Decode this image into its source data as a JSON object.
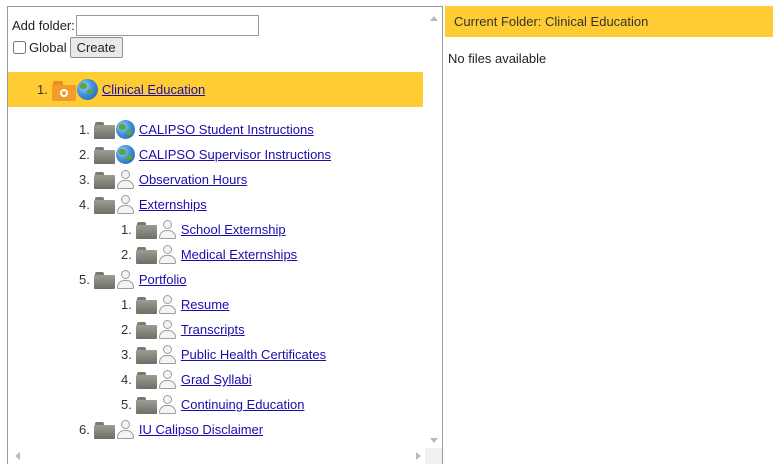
{
  "form": {
    "add_folder_label": "Add folder:",
    "folder_input_value": "",
    "global_label": "Global",
    "global_checked": false,
    "create_label": "Create"
  },
  "tree": {
    "root": {
      "num": "1.",
      "label": "Clinical Education",
      "icon": "globe-icon"
    },
    "items": [
      {
        "num": "1.",
        "label": "CALIPSO Student Instructions",
        "icon": "globe-icon"
      },
      {
        "num": "2.",
        "label": "CALIPSO Supervisor Instructions",
        "icon": "globe-icon"
      },
      {
        "num": "3.",
        "label": "Observation Hours",
        "icon": "user-icon"
      },
      {
        "num": "4.",
        "label": "Externships",
        "icon": "user-icon"
      },
      {
        "num": "1.",
        "label": "School Externship",
        "icon": "user-icon"
      },
      {
        "num": "2.",
        "label": "Medical Externships",
        "icon": "user-icon"
      },
      {
        "num": "5.",
        "label": "Portfolio",
        "icon": "user-icon"
      },
      {
        "num": "1.",
        "label": "Resume",
        "icon": "user-icon"
      },
      {
        "num": "2.",
        "label": "Transcripts",
        "icon": "user-icon"
      },
      {
        "num": "3.",
        "label": "Public Health Certificates",
        "icon": "user-icon"
      },
      {
        "num": "4.",
        "label": "Grad Syllabi",
        "icon": "user-icon"
      },
      {
        "num": "5.",
        "label": "Continuing Education",
        "icon": "user-icon"
      },
      {
        "num": "6.",
        "label": "IU Calipso Disclaimer",
        "icon": "user-icon"
      }
    ]
  },
  "right_panel": {
    "header": "Current Folder: Clinical Education",
    "empty_message": "No files available"
  },
  "colors": {
    "highlight": "#ffcc33",
    "link": "#1a0dab"
  }
}
